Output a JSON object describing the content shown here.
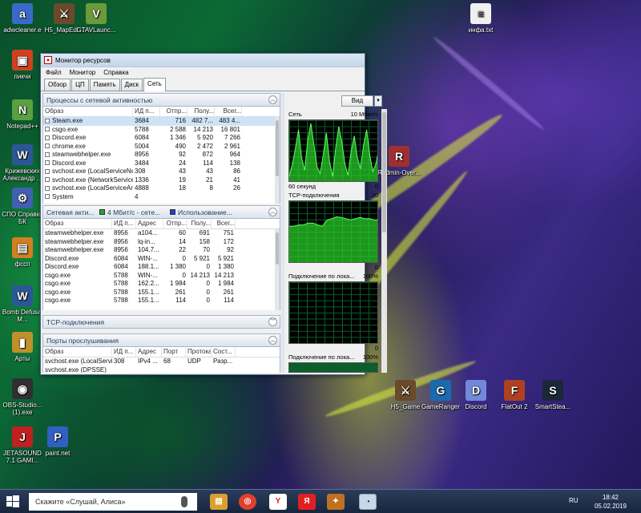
{
  "desktop": {
    "icons": [
      {
        "label": "adwcleaner.e",
        "symbol": "a",
        "color": "#3a6ac8"
      },
      {
        "label": "H5_MapEdi...",
        "symbol": "⚔",
        "color": "#6a4a2a"
      },
      {
        "label": "GTAVLaunc...",
        "symbol": "V",
        "color": "#6a9a3a"
      },
      {
        "label": "инфа.txt",
        "symbol": "≡",
        "color": "#f0f0f0"
      },
      {
        "label": "пикчи",
        "symbol": "▣",
        "color": "#d04020"
      },
      {
        "label": "Notepad++",
        "symbol": "N",
        "color": "#5aa040"
      },
      {
        "label": "Крижевских Александр ...",
        "symbol": "W",
        "color": "#2b5797"
      },
      {
        "label": "СПО Справки БК",
        "symbol": "⚙",
        "color": "#4060b0"
      },
      {
        "label": "Radmin-Over...",
        "symbol": "R",
        "color": "#a03030"
      },
      {
        "label": "фссп",
        "symbol": "▤",
        "color": "#d08020"
      },
      {
        "label": "Bomb Defusal M...",
        "symbol": "W",
        "color": "#2b5797"
      },
      {
        "label": "Арты",
        "symbol": "▮",
        "color": "#c0902a"
      },
      {
        "label": "OBS-Studio... (1).exe",
        "symbol": "◉",
        "color": "#303030"
      },
      {
        "label": "H5_Game",
        "symbol": "⚔",
        "color": "#6a4a2a"
      },
      {
        "label": "GameRanger",
        "symbol": "G",
        "color": "#1a6ab0"
      },
      {
        "label": "Discord",
        "symbol": "D",
        "color": "#7289da"
      },
      {
        "label": "FlatOut 2",
        "symbol": "F",
        "color": "#b04020"
      },
      {
        "label": "SmartStea...",
        "symbol": "S",
        "color": "#1b2838"
      },
      {
        "label": "JETASOUND 7.1 GAMI...",
        "symbol": "J",
        "color": "#c02020"
      },
      {
        "label": "paint.net",
        "symbol": "P",
        "color": "#3060c0"
      }
    ]
  },
  "window": {
    "title": "Монитор ресурсов",
    "menu": [
      "Файл",
      "Монитор",
      "Справка"
    ],
    "tabs": [
      "Обзор",
      "ЦП",
      "Память",
      "Диск",
      "Сеть"
    ],
    "active_tab": "Сеть",
    "processes_section": {
      "title": "Процессы с сетевой активностью",
      "columns": [
        "Образ",
        "ИД п...",
        "Отпр...",
        "Полу...",
        "Всег..."
      ],
      "rows": [
        [
          "Steam.exe",
          "3684",
          "716",
          "482 7...",
          "483 4..."
        ],
        [
          "csgo.exe",
          "5788",
          "2 588",
          "14 213",
          "16 801"
        ],
        [
          "Discord.exe",
          "6084",
          "1 346",
          "5 920",
          "7 266"
        ],
        [
          "chrome.exe",
          "5004",
          "490",
          "2 472",
          "2 961"
        ],
        [
          "steamwebhelper.exe",
          "8956",
          "92",
          "872",
          "964"
        ],
        [
          "Discord.exe",
          "3484",
          "24",
          "114",
          "138"
        ],
        [
          "svchost.exe (LocalServiceNe...",
          "308",
          "43",
          "43",
          "86"
        ],
        [
          "svchost.exe (NetworkService)",
          "1336",
          "19",
          "21",
          "41"
        ],
        [
          "svchost.exe (LocalServiceAn...",
          "4888",
          "18",
          "8",
          "26"
        ],
        [
          "System",
          "4",
          "",
          "",
          ""
        ]
      ]
    },
    "network_section": {
      "title": "Сетевая акти...",
      "legend1": "4 Мбит/с - сете...",
      "legend2": "Использование...",
      "legend1_color": "#22aa22",
      "legend2_color": "#1a3fd0",
      "columns": [
        "Образ",
        "ИД п...",
        "Адрес",
        "Отпр...",
        "Полу...",
        "Всег..."
      ],
      "rows": [
        [
          "steamwebhelper.exe",
          "8956",
          "a104...",
          "60",
          "691",
          "751"
        ],
        [
          "steamwebhelper.exe",
          "8956",
          "lq-in...",
          "14",
          "158",
          "172"
        ],
        [
          "steamwebhelper.exe",
          "8956",
          "104.7...",
          "22",
          "70",
          "92"
        ],
        [
          "Discord.exe",
          "6084",
          "WIN-...",
          "0",
          "5 921",
          "5 921"
        ],
        [
          "Discord.exe",
          "6084",
          "188.1...",
          "1 380",
          "0",
          "1 380"
        ],
        [
          "csgo.exe",
          "5788",
          "WIN-...",
          "0",
          "14 213",
          "14 213"
        ],
        [
          "csgo.exe",
          "5788",
          "162.2...",
          "1 984",
          "0",
          "1 984"
        ],
        [
          "csgo.exe",
          "5788",
          "155.1...",
          "261",
          "0",
          "261"
        ],
        [
          "csgo.exe",
          "5788",
          "155.1...",
          "114",
          "0",
          "114"
        ]
      ]
    },
    "tcp_section": {
      "title": "TCP-подключения"
    },
    "ports_section": {
      "title": "Порты прослушивания",
      "columns": [
        "Образ",
        "ИД п...",
        "Адрес",
        "Порт",
        "Протока...",
        "Сост..."
      ],
      "rows": [
        [
          "svchost.exe (LocalServi...",
          "308",
          "IPv4 ...",
          "68",
          "UDP",
          "Разр..."
        ],
        [
          "svchost.exe (DPSSE)",
          "",
          "",
          "",
          "",
          ""
        ]
      ]
    },
    "right_pane": {
      "view_button": "Вид",
      "graphs": [
        {
          "title": "Сеть",
          "top_right": "10 Мбит/с",
          "bottom_left": "60 секунд",
          "bottom_right": "0"
        },
        {
          "title": "TCP-подключения",
          "top_right": "20",
          "bottom_left": "",
          "bottom_right": "0"
        },
        {
          "title": "Подключение по лока...",
          "top_right": "100%",
          "bottom_left": "",
          "bottom_right": "0"
        },
        {
          "title": "Подключение по лока...",
          "top_right": "100%",
          "bottom_left": "",
          "bottom_right": "0"
        }
      ],
      "network_graph_fraction": [
        0.1,
        0.3,
        0.55,
        0.85,
        0.4,
        0.2,
        0.7,
        0.95,
        0.6,
        0.25,
        0.15,
        0.45,
        0.8,
        0.35,
        0.1,
        0.55,
        0.9,
        0.65,
        0.3,
        0.12,
        0.5,
        0.75,
        0.4,
        0.22,
        0.6,
        0.85,
        0.45,
        0.18,
        0.3,
        0.55
      ],
      "tcp_graph_fraction": [
        0.6,
        0.6,
        0.62,
        0.62,
        0.65,
        0.65,
        0.62,
        0.6,
        0.7,
        0.72,
        0.75,
        0.74,
        0.72,
        0.7,
        0.72,
        0.74,
        0.72,
        0.72,
        0.7,
        0.7
      ]
    }
  },
  "taskbar": {
    "search_placeholder": "Скажите «Слушай, Алиса»",
    "language": "RU",
    "time": "18:42",
    "date": "05.02.2019"
  }
}
